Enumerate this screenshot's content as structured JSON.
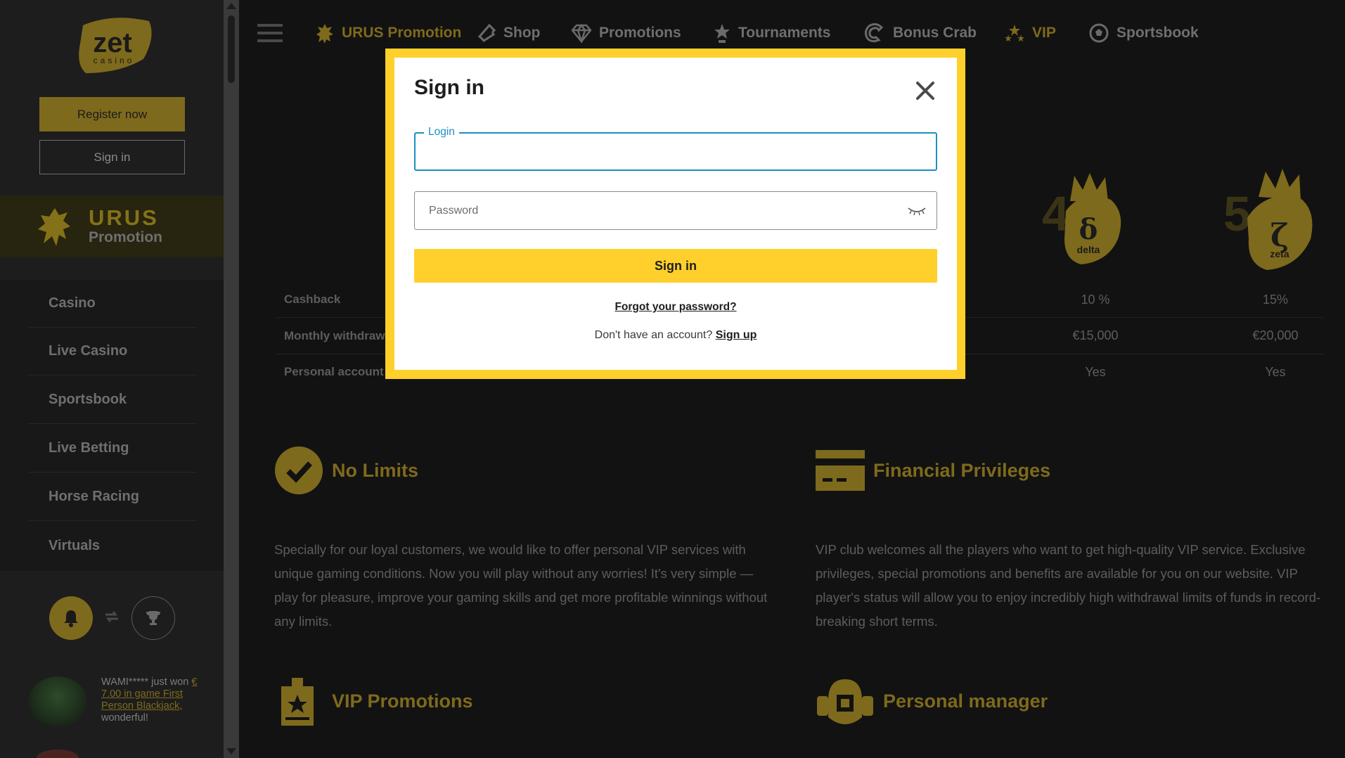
{
  "sidebar": {
    "logo": {
      "main": "zet",
      "sub": "casino"
    },
    "register_label": "Register now",
    "signin_label": "Sign in",
    "promo": {
      "title": "URUS",
      "subtitle": "Promotion"
    },
    "nav": [
      {
        "label": "Casino"
      },
      {
        "label": "Live Casino"
      },
      {
        "label": "Sportsbook"
      },
      {
        "label": "Live Betting"
      },
      {
        "label": "Horse Racing"
      },
      {
        "label": "Virtuals"
      }
    ],
    "winner": {
      "user": "WAMI*****",
      "prefix": " just won ",
      "amount_link": "€ 7.00 in game First Person Blackjack,",
      "suffix": " wonderful!"
    }
  },
  "topnav": {
    "items": [
      {
        "label": "URUS Promotion",
        "icon": "bull-icon"
      },
      {
        "label": "Shop",
        "icon": "ticket-icon"
      },
      {
        "label": "Promotions",
        "icon": "diamond-icon"
      },
      {
        "label": "Tournaments",
        "icon": "star-trophy-icon"
      },
      {
        "label": "Bonus Crab",
        "icon": "crab-claw-icon"
      },
      {
        "label": "VIP",
        "icon": "stars-icon"
      },
      {
        "label": "Sportsbook",
        "icon": "soccer-ball-icon"
      }
    ]
  },
  "vip_table": {
    "badges": [
      {
        "number": "4",
        "letter": "δ",
        "name": "delta"
      },
      {
        "number": "5",
        "letter": "ζ",
        "name": "zeta"
      }
    ],
    "rows": [
      {
        "label": "Cashback",
        "values": [
          "10 %",
          "15%"
        ]
      },
      {
        "label": "Monthly withdraw",
        "values": [
          "€15,000",
          "€20,000"
        ]
      },
      {
        "label": "Personal account",
        "values": [
          "Yes",
          "Yes"
        ]
      }
    ]
  },
  "features": {
    "no_limits": {
      "title": "No Limits",
      "text": "Specially for our loyal customers, we would like to offer personal VIP services with unique gaming conditions. Now you will play without any worries! It's very simple — play for pleasure, improve your gaming skills and get more profitable winnings without any limits."
    },
    "financial": {
      "title": "Financial Privileges",
      "text": "VIP club welcomes all the players who want to get high-quality VIP service. Exclusive privileges, special promotions and benefits are available for you on our website. VIP player's status will allow you to enjoy incredibly high withdrawal limits of funds in record-breaking short terms."
    },
    "vip_promotions": {
      "title": "VIP Promotions"
    },
    "personal_manager": {
      "title": "Personal manager"
    }
  },
  "modal": {
    "title": "Sign in",
    "login_label": "Login",
    "login_value": "",
    "password_placeholder": "Password",
    "submit_label": "Sign in",
    "forgot_label": "Forgot your password?",
    "no_account_text": "Don't have an account? ",
    "signup_label": "Sign up"
  },
  "colors": {
    "gold": "#7e6a1c",
    "modal_accent": "#ffd02b",
    "focus_blue": "#1a8fc3",
    "background": "#121212"
  }
}
